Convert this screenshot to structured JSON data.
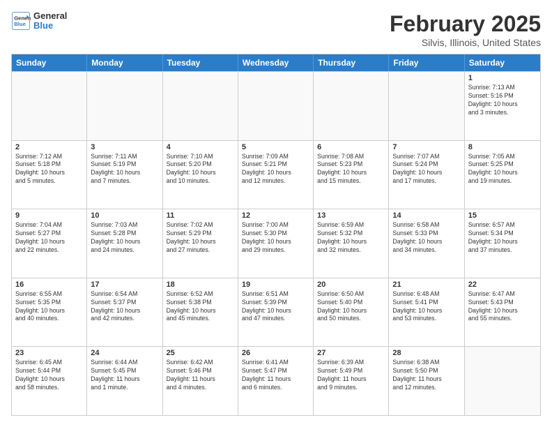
{
  "logo": {
    "line1": "General",
    "line2": "Blue"
  },
  "title": "February 2025",
  "subtitle": "Silvis, Illinois, United States",
  "weekdays": [
    "Sunday",
    "Monday",
    "Tuesday",
    "Wednesday",
    "Thursday",
    "Friday",
    "Saturday"
  ],
  "weeks": [
    [
      {
        "day": "",
        "info": ""
      },
      {
        "day": "",
        "info": ""
      },
      {
        "day": "",
        "info": ""
      },
      {
        "day": "",
        "info": ""
      },
      {
        "day": "",
        "info": ""
      },
      {
        "day": "",
        "info": ""
      },
      {
        "day": "1",
        "info": "Sunrise: 7:13 AM\nSunset: 5:16 PM\nDaylight: 10 hours\nand 3 minutes."
      }
    ],
    [
      {
        "day": "2",
        "info": "Sunrise: 7:12 AM\nSunset: 5:18 PM\nDaylight: 10 hours\nand 5 minutes."
      },
      {
        "day": "3",
        "info": "Sunrise: 7:11 AM\nSunset: 5:19 PM\nDaylight: 10 hours\nand 7 minutes."
      },
      {
        "day": "4",
        "info": "Sunrise: 7:10 AM\nSunset: 5:20 PM\nDaylight: 10 hours\nand 10 minutes."
      },
      {
        "day": "5",
        "info": "Sunrise: 7:09 AM\nSunset: 5:21 PM\nDaylight: 10 hours\nand 12 minutes."
      },
      {
        "day": "6",
        "info": "Sunrise: 7:08 AM\nSunset: 5:23 PM\nDaylight: 10 hours\nand 15 minutes."
      },
      {
        "day": "7",
        "info": "Sunrise: 7:07 AM\nSunset: 5:24 PM\nDaylight: 10 hours\nand 17 minutes."
      },
      {
        "day": "8",
        "info": "Sunrise: 7:05 AM\nSunset: 5:25 PM\nDaylight: 10 hours\nand 19 minutes."
      }
    ],
    [
      {
        "day": "9",
        "info": "Sunrise: 7:04 AM\nSunset: 5:27 PM\nDaylight: 10 hours\nand 22 minutes."
      },
      {
        "day": "10",
        "info": "Sunrise: 7:03 AM\nSunset: 5:28 PM\nDaylight: 10 hours\nand 24 minutes."
      },
      {
        "day": "11",
        "info": "Sunrise: 7:02 AM\nSunset: 5:29 PM\nDaylight: 10 hours\nand 27 minutes."
      },
      {
        "day": "12",
        "info": "Sunrise: 7:00 AM\nSunset: 5:30 PM\nDaylight: 10 hours\nand 29 minutes."
      },
      {
        "day": "13",
        "info": "Sunrise: 6:59 AM\nSunset: 5:32 PM\nDaylight: 10 hours\nand 32 minutes."
      },
      {
        "day": "14",
        "info": "Sunrise: 6:58 AM\nSunset: 5:33 PM\nDaylight: 10 hours\nand 34 minutes."
      },
      {
        "day": "15",
        "info": "Sunrise: 6:57 AM\nSunset: 5:34 PM\nDaylight: 10 hours\nand 37 minutes."
      }
    ],
    [
      {
        "day": "16",
        "info": "Sunrise: 6:55 AM\nSunset: 5:35 PM\nDaylight: 10 hours\nand 40 minutes."
      },
      {
        "day": "17",
        "info": "Sunrise: 6:54 AM\nSunset: 5:37 PM\nDaylight: 10 hours\nand 42 minutes."
      },
      {
        "day": "18",
        "info": "Sunrise: 6:52 AM\nSunset: 5:38 PM\nDaylight: 10 hours\nand 45 minutes."
      },
      {
        "day": "19",
        "info": "Sunrise: 6:51 AM\nSunset: 5:39 PM\nDaylight: 10 hours\nand 47 minutes."
      },
      {
        "day": "20",
        "info": "Sunrise: 6:50 AM\nSunset: 5:40 PM\nDaylight: 10 hours\nand 50 minutes."
      },
      {
        "day": "21",
        "info": "Sunrise: 6:48 AM\nSunset: 5:41 PM\nDaylight: 10 hours\nand 53 minutes."
      },
      {
        "day": "22",
        "info": "Sunrise: 6:47 AM\nSunset: 5:43 PM\nDaylight: 10 hours\nand 55 minutes."
      }
    ],
    [
      {
        "day": "23",
        "info": "Sunrise: 6:45 AM\nSunset: 5:44 PM\nDaylight: 10 hours\nand 58 minutes."
      },
      {
        "day": "24",
        "info": "Sunrise: 6:44 AM\nSunset: 5:45 PM\nDaylight: 11 hours\nand 1 minute."
      },
      {
        "day": "25",
        "info": "Sunrise: 6:42 AM\nSunset: 5:46 PM\nDaylight: 11 hours\nand 4 minutes."
      },
      {
        "day": "26",
        "info": "Sunrise: 6:41 AM\nSunset: 5:47 PM\nDaylight: 11 hours\nand 6 minutes."
      },
      {
        "day": "27",
        "info": "Sunrise: 6:39 AM\nSunset: 5:49 PM\nDaylight: 11 hours\nand 9 minutes."
      },
      {
        "day": "28",
        "info": "Sunrise: 6:38 AM\nSunset: 5:50 PM\nDaylight: 11 hours\nand 12 minutes."
      },
      {
        "day": "",
        "info": ""
      }
    ]
  ]
}
